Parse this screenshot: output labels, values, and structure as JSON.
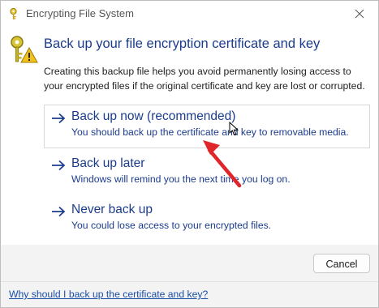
{
  "window": {
    "title": "Encrypting File System"
  },
  "main": {
    "heading": "Back up your file encryption certificate and key",
    "description": "Creating this backup file helps you avoid permanently losing access to your encrypted files if the original certificate and key are lost or corrupted.",
    "options": [
      {
        "title": "Back up now (recommended)",
        "subtitle": "You should back up the certificate and key to removable media."
      },
      {
        "title": "Back up later",
        "subtitle": "Windows will remind you the next time you log on."
      },
      {
        "title": "Never back up",
        "subtitle": "You could lose access to your encrypted files."
      }
    ]
  },
  "footer": {
    "cancel_label": "Cancel",
    "help_link": "Why should I back up the certificate and key?"
  },
  "colors": {
    "accent": "#1b3b8c",
    "link": "#1a4ea8",
    "annotation": "#e0262b"
  },
  "icons": [
    "key-warning-icon",
    "close-icon",
    "arrow-right-icon",
    "mouse-cursor-icon"
  ]
}
